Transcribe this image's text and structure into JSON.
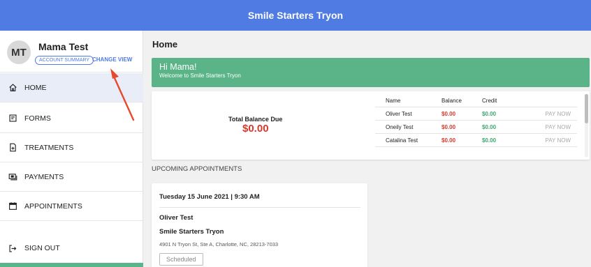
{
  "header": {
    "title": "Smile Starters Tryon"
  },
  "profile": {
    "initials": "MT",
    "name": "Mama Test",
    "account_summary_label": "ACCOUNT SUMMARY",
    "change_view_label": "CHANGE VIEW"
  },
  "sidebar": {
    "items": [
      {
        "label": "HOME",
        "icon": "home-icon",
        "active": true
      },
      {
        "label": "FORMS",
        "icon": "forms-icon"
      },
      {
        "label": "TREATMENTS",
        "icon": "treatments-icon"
      },
      {
        "label": "PAYMENTS",
        "icon": "payments-icon"
      },
      {
        "label": "APPOINTMENTS",
        "icon": "calendar-icon"
      },
      {
        "label": "SIGN OUT",
        "icon": "sign-out-icon"
      }
    ]
  },
  "main": {
    "page_title": "Home",
    "welcome": {
      "greeting": "Hi Mama!",
      "subtitle": "Welcome to Smile Starters Tryon"
    },
    "balance": {
      "total_label": "Total Balance Due",
      "total_value": "$0.00",
      "columns": [
        "Name",
        "Balance",
        "Credit"
      ],
      "rows": [
        {
          "name": "Oliver Test",
          "balance": "$0.00",
          "credit": "$0.00",
          "action": "PAY NOW"
        },
        {
          "name": "Oneily Test",
          "balance": "$0.00",
          "credit": "$0.00",
          "action": "PAY NOW"
        },
        {
          "name": "Catalina Test",
          "balance": "$0.00",
          "credit": "$0.00",
          "action": "PAY NOW"
        }
      ]
    },
    "upcoming": {
      "heading": "UPCOMING APPOINTMENTS",
      "appointment": {
        "datetime": "Tuesday 15 June 2021 | 9:30 AM",
        "patient": "Oliver Test",
        "location": "Smile Starters Tryon",
        "address": "4901 N Tryon St, Ste A, Charlotte, NC, 28213-7033",
        "status": "Scheduled"
      }
    }
  },
  "colors": {
    "brand": "#4f7be3",
    "success": "#5ab487",
    "danger": "#d9382c",
    "annotation_arrow": "#e8492c"
  }
}
